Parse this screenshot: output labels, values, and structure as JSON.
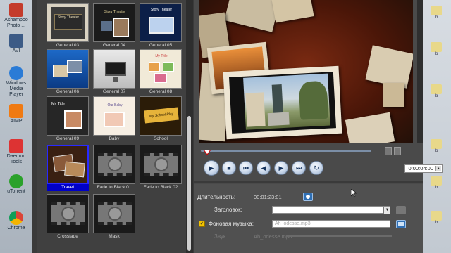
{
  "desktop": {
    "left_icons": [
      {
        "label": "Ashampoo Photo ..."
      },
      {
        "label": "AVI"
      },
      {
        "label": "Windows Media Player"
      },
      {
        "label": "AIMP"
      },
      {
        "label": "Daemon Tools"
      },
      {
        "label": "uTorrent"
      },
      {
        "label": "Chrome"
      }
    ],
    "right_icons": [
      {
        "label": "ib"
      },
      {
        "label": "ib"
      },
      {
        "label": "ib"
      },
      {
        "label": "ib"
      },
      {
        "label": "ib"
      },
      {
        "label": "ib"
      }
    ]
  },
  "templates": [
    {
      "label": "General 03"
    },
    {
      "label": "General 04"
    },
    {
      "label": "General 05"
    },
    {
      "label": "General 06"
    },
    {
      "label": "General 07"
    },
    {
      "label": "General 08"
    },
    {
      "label": "General 09"
    },
    {
      "label": "Baby"
    },
    {
      "label": "School"
    },
    {
      "label": "Travel"
    },
    {
      "label": "Fade to Black 01"
    },
    {
      "label": "Fade to Black 02"
    },
    {
      "label": "Crossfade"
    },
    {
      "label": "Mask"
    }
  ],
  "thumb_text": {
    "story_theater": "Story Theater",
    "my_title": "My Title",
    "our_baby": "Our Baby",
    "my_school_play": "My School Play"
  },
  "playback": {
    "time": "0:00:04:00"
  },
  "properties": {
    "duration_label": "Длительность:",
    "duration_value": "00:01:23:01",
    "title_label": "Заголовок:",
    "title_value": "",
    "music_label": "Фоновая музыка:",
    "music_value": "Ah_odesse.mp3",
    "music_checked": true,
    "sound_label": "Звук",
    "sound_value": "Ah_odesse.mp3"
  },
  "colors": {
    "selection": "#0000c8",
    "accent_check": "#f2c200"
  }
}
